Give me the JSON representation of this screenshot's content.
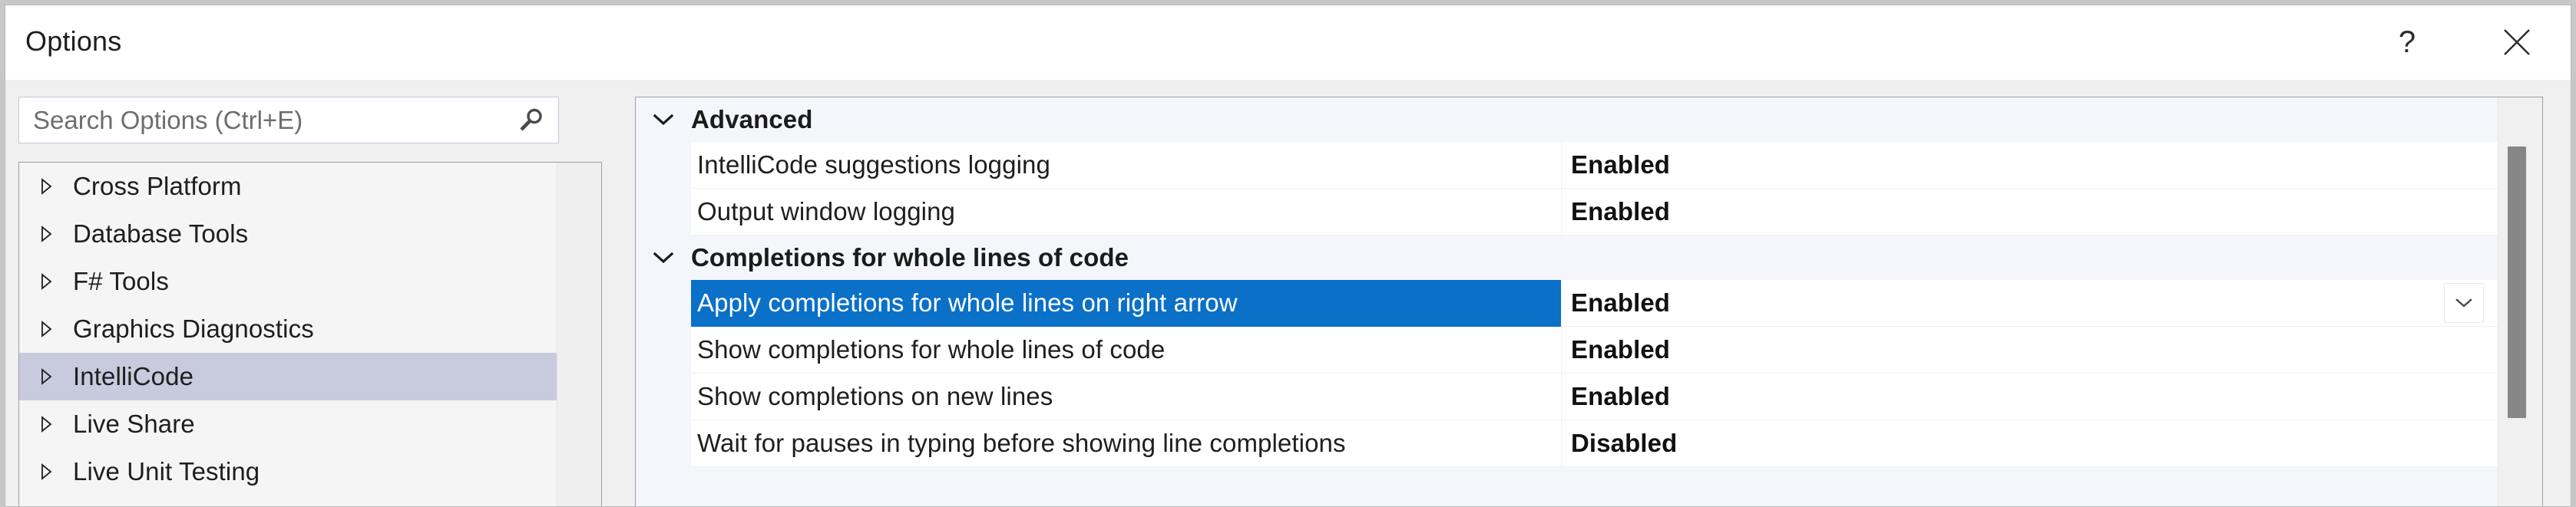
{
  "window": {
    "title": "Options",
    "help_icon": "question-mark-icon",
    "close_icon": "close-icon"
  },
  "search": {
    "placeholder": "Search Options (Ctrl+E)",
    "value": "",
    "icon": "search-icon"
  },
  "category_tree": {
    "items": [
      {
        "label": "Cross Platform",
        "expander": "chevron-right-icon",
        "selected": false
      },
      {
        "label": "Database Tools",
        "expander": "chevron-right-icon",
        "selected": false
      },
      {
        "label": "F# Tools",
        "expander": "chevron-right-icon",
        "selected": false
      },
      {
        "label": "Graphics Diagnostics",
        "expander": "chevron-right-icon",
        "selected": false
      },
      {
        "label": "IntelliCode",
        "expander": "chevron-right-icon",
        "selected": true
      },
      {
        "label": "Live Share",
        "expander": "chevron-right-icon",
        "selected": false
      },
      {
        "label": "Live Unit Testing",
        "expander": "chevron-right-icon",
        "selected": false
      }
    ],
    "selected_label": "IntelliCode",
    "selected_color": "#c8cade"
  },
  "settings": {
    "groups": [
      {
        "title": "Advanced",
        "expander": "chevron-down-icon",
        "rows": [
          {
            "name": "IntelliCode suggestions logging",
            "value": "Enabled",
            "selected": false
          },
          {
            "name": "Output window logging",
            "value": "Enabled",
            "selected": false
          }
        ]
      },
      {
        "title": "Completions for whole lines of code",
        "expander": "chevron-down-icon",
        "rows": [
          {
            "name": "Apply completions for whole lines on right arrow",
            "value": "Enabled",
            "selected": true
          },
          {
            "name": "Show completions for whole lines of code",
            "value": "Enabled",
            "selected": false
          },
          {
            "name": "Show completions on new lines",
            "value": "Enabled",
            "selected": false
          },
          {
            "name": "Wait for pauses in typing before showing line completions",
            "value": "Disabled",
            "selected": false
          }
        ]
      }
    ],
    "selected_row_name": "Apply completions for whole lines on right arrow",
    "selection_color": "#0a70c8",
    "dropdown_icon": "chevron-down-icon"
  },
  "scrollbars": {
    "settings_thumb_color": "#868686"
  }
}
